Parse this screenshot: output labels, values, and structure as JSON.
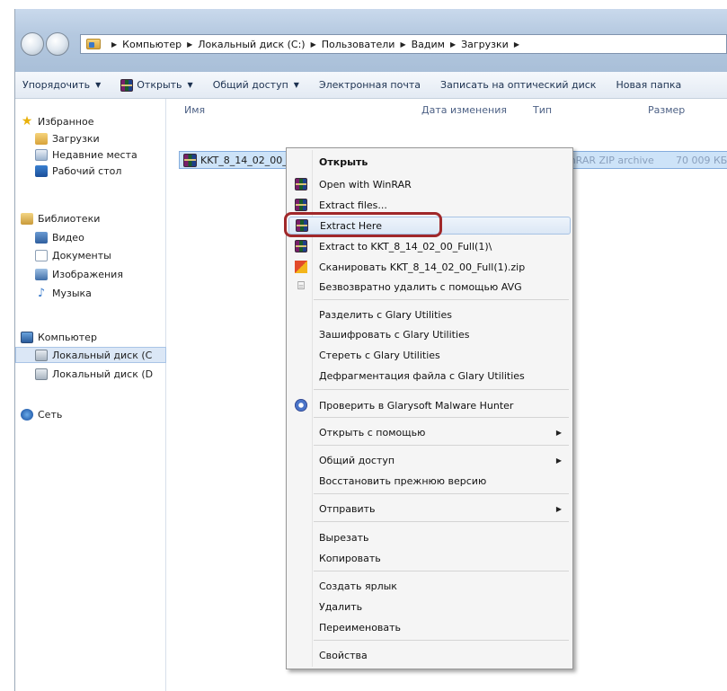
{
  "address": {
    "crumbs": [
      "Компьютер",
      "Локальный диск (C:)",
      "Пользователи",
      "Вадим",
      "Загрузки"
    ]
  },
  "toolbar": {
    "organize": "Упорядочить",
    "open": "Открыть",
    "share": "Общий доступ",
    "email": "Электронная почта",
    "burn": "Записать на оптический диск",
    "new_folder": "Новая папка"
  },
  "nav": {
    "favorites": "Избранное",
    "downloads": "Загрузки",
    "recent": "Недавние места",
    "desktop": "Рабочий стол",
    "libraries": "Библиотеки",
    "video": "Видео",
    "documents": "Документы",
    "pictures": "Изображения",
    "music": "Музыка",
    "computer": "Компьютер",
    "disk_c": "Локальный диск (C",
    "disk_d": "Локальный диск (D",
    "network": "Сеть"
  },
  "columns": {
    "name": "Имя",
    "date": "Дата изменения",
    "type": "Тип",
    "size": "Размер"
  },
  "file": {
    "name": "KKT_8_14_02_00_F",
    "type": "WinRAR ZIP archive",
    "size": "70 009 КБ"
  },
  "menu": {
    "open": "Открыть",
    "open_winrar": "Open with WinRAR",
    "extract_files": "Extract files...",
    "extract_here": "Extract Here",
    "extract_to": "Extract to KKT_8_14_02_00_Full(1)\\",
    "scan": "Сканировать KKT_8_14_02_00_Full(1).zip",
    "avg_delete": "Безвозвратно удалить с помощью AVG",
    "glary_split": "Разделить с Glary Utilities",
    "glary_encrypt": "Зашифровать с Glary Utilities",
    "glary_wipe": "Стереть с Glary Utilities",
    "glary_defrag": "Дефрагментация файла с Glary Utilities",
    "malware_hunter": "Проверить в Glarysoft Malware Hunter",
    "open_with": "Открыть с помощью",
    "share": "Общий доступ",
    "restore": "Восстановить прежнюю версию",
    "send_to": "Отправить",
    "cut": "Вырезать",
    "copy": "Копировать",
    "shortcut": "Создать ярлык",
    "delete": "Удалить",
    "rename": "Переименовать",
    "properties": "Свойства"
  }
}
